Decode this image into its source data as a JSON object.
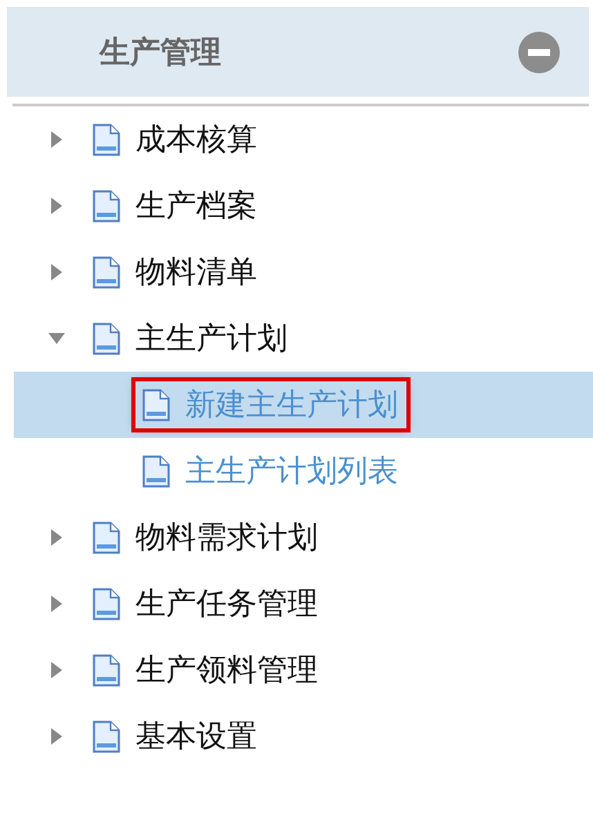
{
  "panel": {
    "title": "生产管理",
    "collapse_button": true
  },
  "tree": [
    {
      "label": "成本核算",
      "expanded": false
    },
    {
      "label": "生产档案",
      "expanded": false
    },
    {
      "label": "物料清单",
      "expanded": false
    },
    {
      "label": "主生产计划",
      "expanded": true,
      "children": [
        {
          "label": "新建主生产计划",
          "selected": true,
          "highlighted": true
        },
        {
          "label": "主生产计划列表",
          "selected": false,
          "highlighted": false
        }
      ]
    },
    {
      "label": "物料需求计划",
      "expanded": false
    },
    {
      "label": "生产任务管理",
      "expanded": false
    },
    {
      "label": "生产领料管理",
      "expanded": false
    },
    {
      "label": "基本设置",
      "expanded": false
    }
  ]
}
